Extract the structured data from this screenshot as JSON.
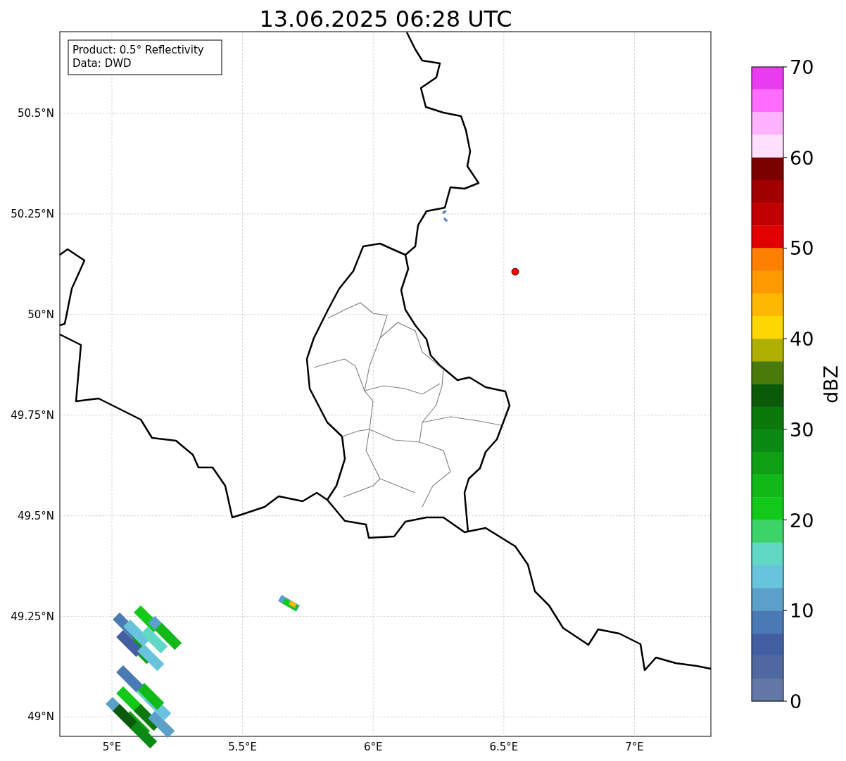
{
  "title": "13.06.2025 06:28 UTC",
  "info_box": {
    "lines": [
      "Product: 0.5° Reflectivity",
      "Data: DWD"
    ]
  },
  "y_ticks": [
    "50.5°N",
    "50.25°N",
    "50°N",
    "49.75°N",
    "49.5°N",
    "49.25°N",
    "49°N"
  ],
  "x_ticks": [
    "5°E",
    "5.5°E",
    "6°E",
    "6.5°E",
    "7°E"
  ],
  "colorbar": {
    "label": "dBZ",
    "ticks": [
      "70",
      "60",
      "50",
      "40",
      "30",
      "20",
      "10",
      "0"
    ],
    "segments": [
      {
        "color": "#e93cf0"
      },
      {
        "color": "#ff6cff"
      },
      {
        "color": "#ffb3ff"
      },
      {
        "color": "#ffe0ff"
      },
      {
        "color": "#7a0000"
      },
      {
        "color": "#a00000"
      },
      {
        "color": "#c00000"
      },
      {
        "color": "#e00000"
      },
      {
        "color": "#ff7f00"
      },
      {
        "color": "#ff9900"
      },
      {
        "color": "#ffb700"
      },
      {
        "color": "#ffd700"
      },
      {
        "color": "#afaf00"
      },
      {
        "color": "#4a7a0a"
      },
      {
        "color": "#0a5a0a"
      },
      {
        "color": "#0a780a"
      },
      {
        "color": "#0a8a14"
      },
      {
        "color": "#0ea012"
      },
      {
        "color": "#10b818"
      },
      {
        "color": "#12c818"
      },
      {
        "color": "#3cd468"
      },
      {
        "color": "#60d8c4"
      },
      {
        "color": "#68c4dc"
      },
      {
        "color": "#5aa0c8"
      },
      {
        "color": "#4a7ab4"
      },
      {
        "color": "#425fa2"
      },
      {
        "color": "#5068a0"
      },
      {
        "color": "#6478a8"
      }
    ]
  }
}
